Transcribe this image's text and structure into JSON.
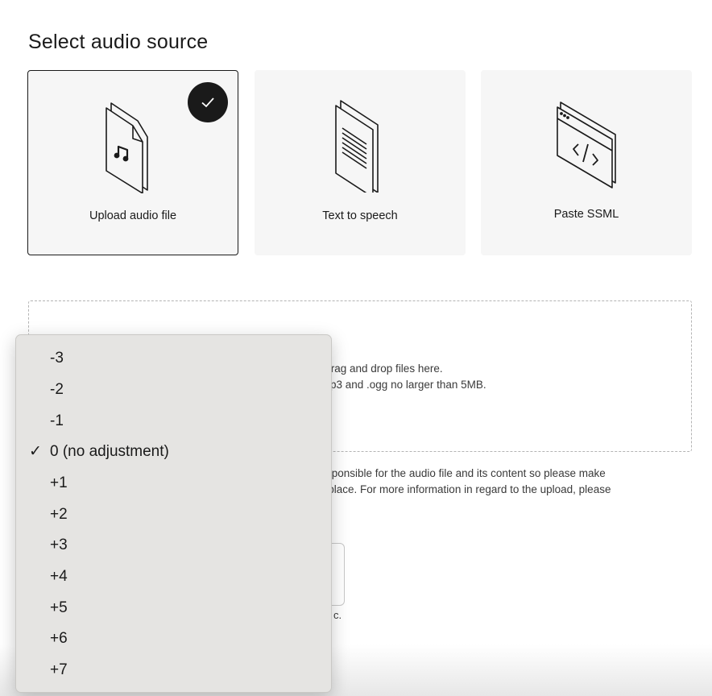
{
  "page": {
    "heading": "Select audio source"
  },
  "sources": [
    {
      "label": "Upload audio file",
      "icon": "audio-file-icon",
      "selected": true
    },
    {
      "label": "Text to speech",
      "icon": "text-document-icon",
      "selected": false
    },
    {
      "label": "Paste SSML",
      "icon": "code-window-icon",
      "selected": false
    }
  ],
  "dropzone": {
    "line1": "r drag and drop files here.",
    "line2": ".mp3 and .ogg no larger than 5MB."
  },
  "notice": {
    "line1": "responsible for the audio file and its content so please make",
    "line2": "in place. For more information in regard to the upload, please"
  },
  "field": {
    "hint": "c."
  },
  "dropdown": {
    "selected": "0 (no adjustment)",
    "options": [
      "-3",
      "-2",
      "-1",
      "0 (no adjustment)",
      "+1",
      "+2",
      "+3",
      "+4",
      "+5",
      "+6",
      "+7"
    ],
    "check_glyph": "✓"
  },
  "colors": {
    "text": "#1a1a1a",
    "card_bg": "#f6f6f6",
    "menu_bg": "#e5e4e2",
    "accent_red": "#d0443e"
  }
}
